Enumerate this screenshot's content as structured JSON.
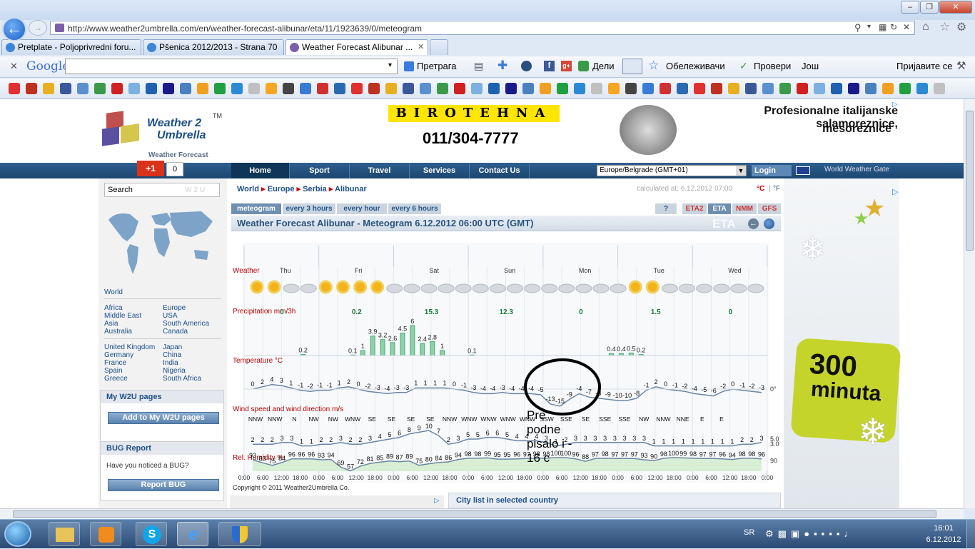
{
  "browser": {
    "url": "http://www.weather2umbrella.com/en/weather-forecast-alibunar/eta/11/1923639/0/meteogram",
    "tabs": [
      {
        "label": "Pretplate - Poljoprivredni foru..."
      },
      {
        "label": "Pšenica 2012/2013 - Strana 70"
      },
      {
        "label": "Weather Forecast Alibunar ..."
      }
    ],
    "google_label": "Google",
    "toolbar": {
      "search": "Претрага",
      "share": "Дели",
      "bookmarks": "Обележивачи",
      "check": "Провери",
      "more": "Још",
      "login": "Пријавите се"
    }
  },
  "site": {
    "logo_line1": "Weather 2",
    "logo_line2": "Umbrella",
    "logo_tm": "TM",
    "logo_sub": "Weather Forecast",
    "gplus": "+1",
    "gplus_count": "0",
    "ad_brand": "BIROTEHNA",
    "ad_phone": "011/304-7777",
    "ad_text1": "Profesionalne italijanske salamoreznice,",
    "ad_text2": "mesoreznice",
    "nav": [
      "Home",
      "Sport",
      "Travel",
      "Services",
      "Contact Us"
    ],
    "timezone": "Europe/Belgrade (GMT+01)",
    "login": "Login",
    "gate": "World Weather Gate",
    "breadcrumb": [
      "World",
      "Europe",
      "Serbia",
      "Alibunar"
    ],
    "calculated": "calculated at: 6.12.2012 07:00",
    "unit_c": "°C",
    "unit_f": "°F",
    "unit_sep": "|",
    "view_tabs": [
      "meteogram",
      "every 3 hours",
      "every hour",
      "every 6 hours"
    ],
    "model_tabs": [
      "?",
      "ETA2",
      "ETA",
      "NMM",
      "GFS"
    ],
    "chart_title": "Weather Forecast Alibunar - Meteogram 6.12.2012 06:00 UTC (GMT)",
    "eta_watermark": "ETA",
    "copyright": "Copyright © 2011 Weather2Umbrella Co.",
    "city_list": "City list in selected country"
  },
  "sidebar": {
    "search": "Search",
    "w2u": "W2U",
    "world": "World",
    "regions_left": [
      "Africa",
      "Middle East",
      "Asia",
      "Australia"
    ],
    "regions_right": [
      "Europe",
      "USA",
      "South America",
      "Canada"
    ],
    "countries_left": [
      "United Kingdom",
      "Germany",
      "France",
      "Spain",
      "Greece"
    ],
    "countries_right": [
      "Japan",
      "China",
      "India",
      "Nigeria",
      "South Africa"
    ],
    "w2u_title": "My W2U pages",
    "w2u_btn": "Add to My W2U pages",
    "bug_title": "BUG Report",
    "bug_text": "Have you noticed a BUG?",
    "bug_btn": "Report BUG"
  },
  "rightad": {
    "big": "300",
    "small": "minuta"
  },
  "annotation": {
    "line1": "Pre",
    "line2": "podne",
    "line3": "pisalo i -",
    "line4": "16 c"
  },
  "taskbar": {
    "lang": "SR",
    "time": "16:01",
    "date": "6.12.2012"
  },
  "chart_data": {
    "type": "line",
    "rows": [
      "Weather",
      "Precipitation mm/3h",
      "Temperature °C",
      "Wind speed and wind direction m/s",
      "Rel. Humidity %"
    ],
    "days": [
      "Thu",
      "Fri",
      "Sat",
      "Sun",
      "Mon",
      "Tue",
      "Wed"
    ],
    "time_labels": [
      "0:00",
      "6:00",
      "12:00",
      "18:00",
      "0:00",
      "6:00",
      "12:00",
      "18:00",
      "0:00",
      "6:00",
      "12:00",
      "18:00",
      "0:00",
      "6:00",
      "12:00",
      "18:00",
      "0:00",
      "6:00",
      "12:00",
      "18:00",
      "0:00",
      "6:00",
      "12:00",
      "18:00",
      "0:00",
      "6:00",
      "12:00",
      "18:00",
      "0:00"
    ],
    "precip_daily_totals": [
      "0",
      "0.2",
      "15.3",
      "12.3",
      "0",
      "1.5",
      "0"
    ],
    "precip_labels": [
      {
        "i": 4,
        "v": "0.2"
      },
      {
        "i": 9,
        "v": "0.1"
      },
      {
        "i": 10,
        "v": "1"
      },
      {
        "i": 11,
        "v": "3.9"
      },
      {
        "i": 12,
        "v": "3.2"
      },
      {
        "i": 13,
        "v": "2.6"
      },
      {
        "i": 14,
        "v": "4.5"
      },
      {
        "i": 15,
        "v": "6"
      },
      {
        "i": 16,
        "v": "2.4"
      },
      {
        "i": 17,
        "v": "2.8"
      },
      {
        "i": 18,
        "v": "1"
      },
      {
        "i": 21,
        "v": "0.1"
      },
      {
        "i": 35,
        "v": "0.4"
      },
      {
        "i": 36,
        "v": "0.4"
      },
      {
        "i": 37,
        "v": "0.5"
      },
      {
        "i": 38,
        "v": "0.2"
      }
    ],
    "precip_values": [
      0,
      0,
      0,
      0,
      0.2,
      0,
      0,
      0,
      0,
      0.1,
      1,
      3.9,
      3.2,
      2.6,
      4.5,
      6,
      2.4,
      2.8,
      1,
      0,
      0,
      0.1,
      0,
      0,
      0,
      0,
      0,
      0,
      0,
      0,
      0,
      0,
      0,
      0,
      0,
      0.4,
      0.4,
      0.5,
      0.2,
      0,
      0,
      0,
      0,
      0,
      0,
      0,
      0,
      0,
      0,
      0
    ],
    "temperature": [
      "0",
      "2",
      "4",
      "3",
      "1",
      "-1",
      "-2",
      "-1",
      "-1",
      "1",
      "2",
      "0",
      "-2",
      "-3",
      "-4",
      "-3",
      "-3",
      "1",
      "1",
      "1",
      "1",
      "0",
      "-1",
      "-3",
      "-4",
      "-4",
      "-3",
      "-4",
      "-4",
      "-4",
      "-5",
      "-13",
      "-15",
      "-9",
      "-4",
      "-7",
      "-8",
      "-9",
      "-10",
      "-10",
      "-8",
      "-1",
      "2",
      "0",
      "-1",
      "-2",
      "-4",
      "-5",
      "-6",
      "-2",
      "0",
      "-1",
      "-2",
      "-3"
    ],
    "temperature_ref": "0°",
    "wind_dir": [
      "NNW",
      "NNW",
      "N",
      "NW",
      "NW",
      "WNW",
      "SE",
      "SE",
      "SE",
      "SE",
      "NNW",
      "WNW",
      "WNW",
      "WNW",
      "WNW",
      "SSW",
      "SSE",
      "SE",
      "SSE",
      "SSE",
      "NW",
      "NNW",
      "NNE",
      "E",
      "E"
    ],
    "wind_speed": [
      "2",
      "2",
      "2",
      "3",
      "3",
      "1",
      "1",
      "2",
      "2",
      "3",
      "2",
      "2",
      "3",
      "4",
      "5",
      "6",
      "8",
      "9",
      "10",
      "7",
      "2",
      "3",
      "5",
      "5",
      "6",
      "6",
      "5",
      "4",
      "4",
      "4",
      "3",
      "1",
      "2",
      "3",
      "3",
      "3",
      "3",
      "3",
      "3",
      "3",
      "3",
      "1",
      "1",
      "1",
      "1",
      "1",
      "1",
      "1",
      "1",
      "1",
      "2",
      "2",
      "3"
    ],
    "wind_ref": [
      "5.0",
      "3.0"
    ],
    "humidity": [
      "93",
      "83",
      "75",
      "84",
      "96",
      "96",
      "96",
      "93",
      "94",
      "69",
      "57",
      "72",
      "81",
      "85",
      "89",
      "87",
      "89",
      "75",
      "80",
      "84",
      "86",
      "94",
      "98",
      "98",
      "99",
      "95",
      "95",
      "96",
      "97",
      "98",
      "98",
      "100",
      "100",
      "96",
      "88",
      "97",
      "98",
      "97",
      "97",
      "97",
      "93",
      "90",
      "98",
      "100",
      "99",
      "98",
      "97",
      "97",
      "96",
      "94",
      "98",
      "98",
      "96"
    ],
    "humidity_ref": "90"
  }
}
